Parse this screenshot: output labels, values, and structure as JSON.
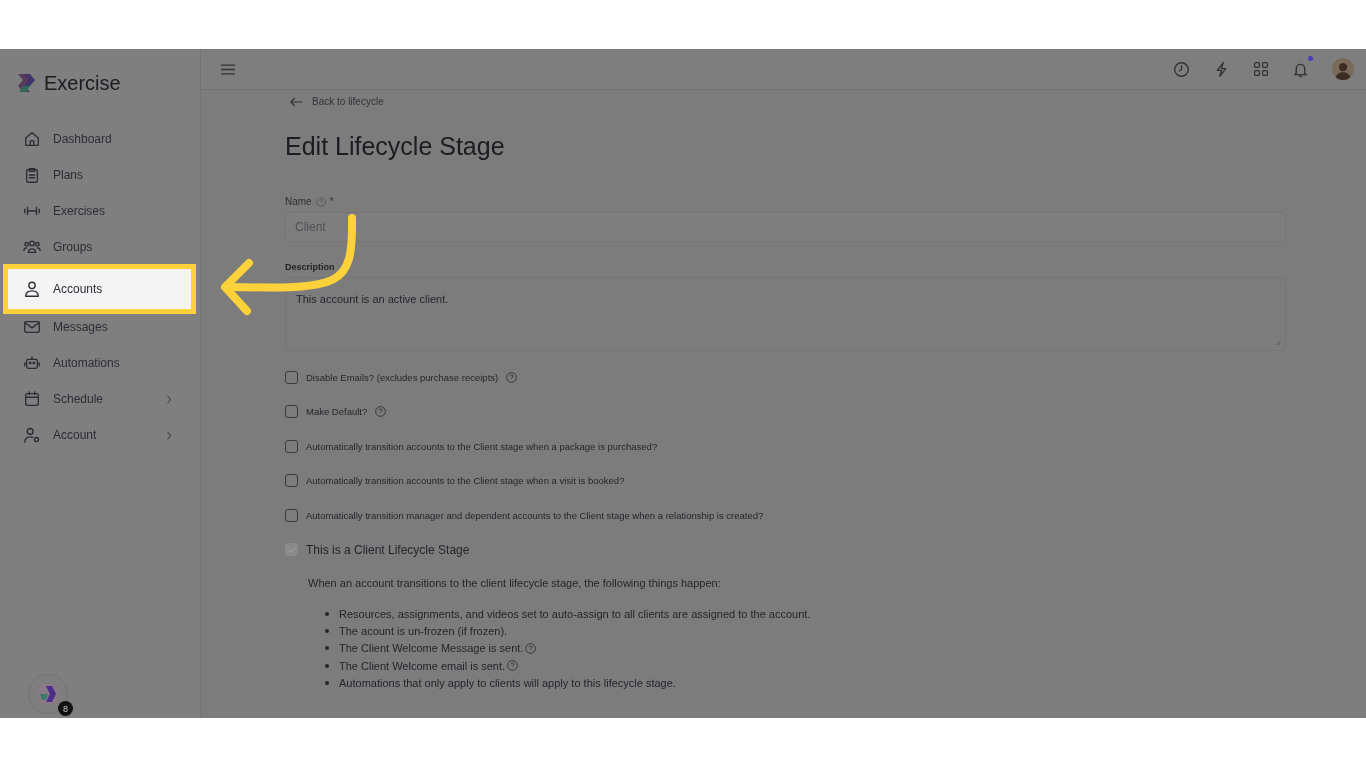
{
  "app": {
    "name": "Exercise"
  },
  "sidebar": {
    "items": [
      {
        "label": "Dashboard",
        "selected": false,
        "expandable": false
      },
      {
        "label": "Plans",
        "selected": false,
        "expandable": false
      },
      {
        "label": "Exercises",
        "selected": false,
        "expandable": false
      },
      {
        "label": "Groups",
        "selected": false,
        "expandable": false
      },
      {
        "label": "Accounts",
        "selected": true,
        "expandable": false
      },
      {
        "label": "Messages",
        "selected": false,
        "expandable": false
      },
      {
        "label": "Automations",
        "selected": false,
        "expandable": false
      },
      {
        "label": "Schedule",
        "selected": false,
        "expandable": true
      },
      {
        "label": "Account",
        "selected": false,
        "expandable": true
      }
    ]
  },
  "topbar": {
    "notification_dot": true
  },
  "back_link": "Back to lifecycle",
  "title": "Edit Lifecycle Stage",
  "name_field": {
    "label": "Name",
    "required_mark": "*",
    "value": "Client",
    "disabled": true
  },
  "description_field": {
    "label": "Description",
    "value": "This account is an active client."
  },
  "checkboxes": [
    {
      "kind": "small",
      "label": "Disable Emails? (excludes purchase receipts)",
      "checked": false,
      "disabled": false,
      "help": true
    },
    {
      "kind": "small",
      "label": "Make Default?",
      "checked": false,
      "disabled": false,
      "help": true
    },
    {
      "kind": "small",
      "label": "Automatically transition accounts to the Client stage when a package is purchased?",
      "checked": false,
      "disabled": false,
      "help": false
    },
    {
      "kind": "small",
      "label": "Automatically transition accounts to the Client stage when a visit is booked?",
      "checked": false,
      "disabled": false,
      "help": false
    },
    {
      "kind": "small",
      "label": "Automatically transition manager and dependent accounts to the Client stage when a relationship is created?",
      "checked": false,
      "disabled": false,
      "help": false
    },
    {
      "kind": "large",
      "label": "This is a Client Lifecycle Stage",
      "checked": true,
      "disabled": true,
      "help": false
    }
  ],
  "note": "When an account transitions to the client lifecycle stage, the following things happen:",
  "bullets": [
    {
      "text": "Resources, assignments, and videos set to auto-assign to all clients are assigned to the account.",
      "help": false
    },
    {
      "text": "The acount is un-frozen (if frozen).",
      "help": false
    },
    {
      "text": "The Client Welcome Message is sent.",
      "help": true
    },
    {
      "text": "The Client Welcome email is sent.",
      "help": true
    },
    {
      "text": "Automations that only apply to clients will apply to this lifecycle stage.",
      "help": false
    }
  ],
  "widget": {
    "badge": "8"
  }
}
